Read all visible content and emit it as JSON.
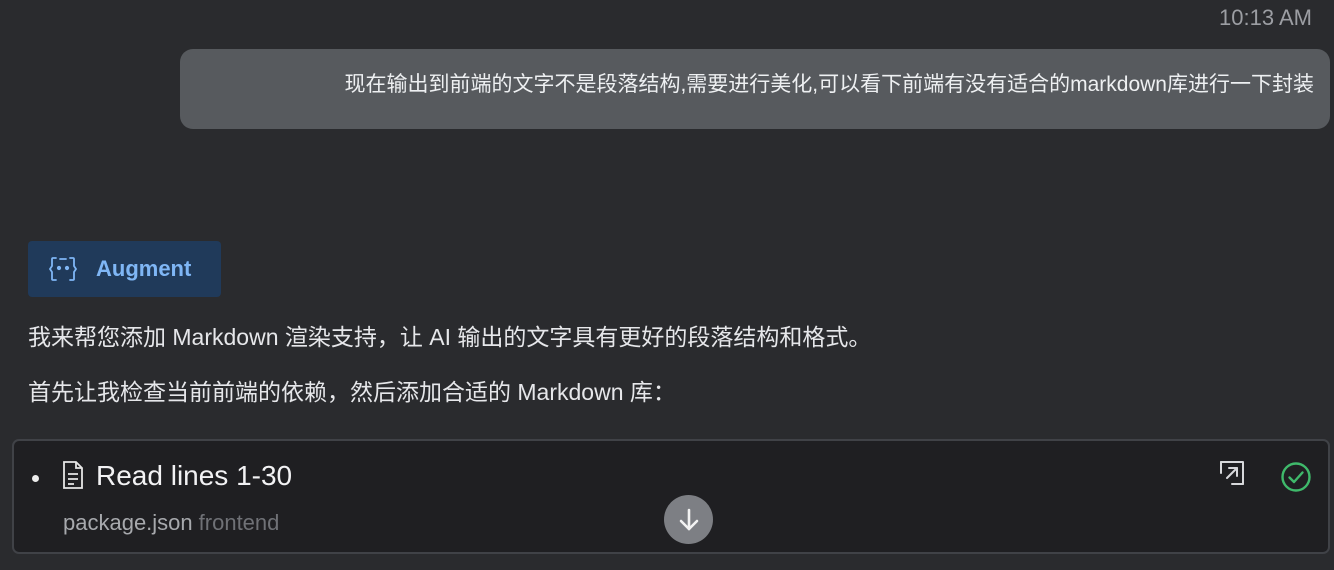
{
  "timestamp": "10:13 AM",
  "user_message": "现在输出到前端的文字不是段落结构,需要进行美化,可以看下前端有没有适合的markdown库进行一下封装",
  "agent": {
    "name": "Augment",
    "icon": "augment-bot-icon"
  },
  "assistant_messages": [
    "我来帮您添加 Markdown 渲染支持，让 AI 输出的文字具有更好的段落结构和格式。",
    "首先让我检查当前前端的依赖，然后添加合适的 Markdown 库："
  ],
  "tool_call": {
    "title": "Read lines 1-30",
    "file_name": "package.json",
    "folder": "frontend",
    "icons": [
      "file-icon",
      "open-external-icon",
      "check-circle-icon"
    ],
    "status": "success"
  },
  "scroll_button": {
    "icon": "arrow-down-icon"
  },
  "colors": {
    "background": "#2a2b2e",
    "user_bubble": "#575a5e",
    "agent_badge_bg": "#203a5a",
    "agent_accent": "#7fb6f5",
    "success": "#3fb96b"
  }
}
